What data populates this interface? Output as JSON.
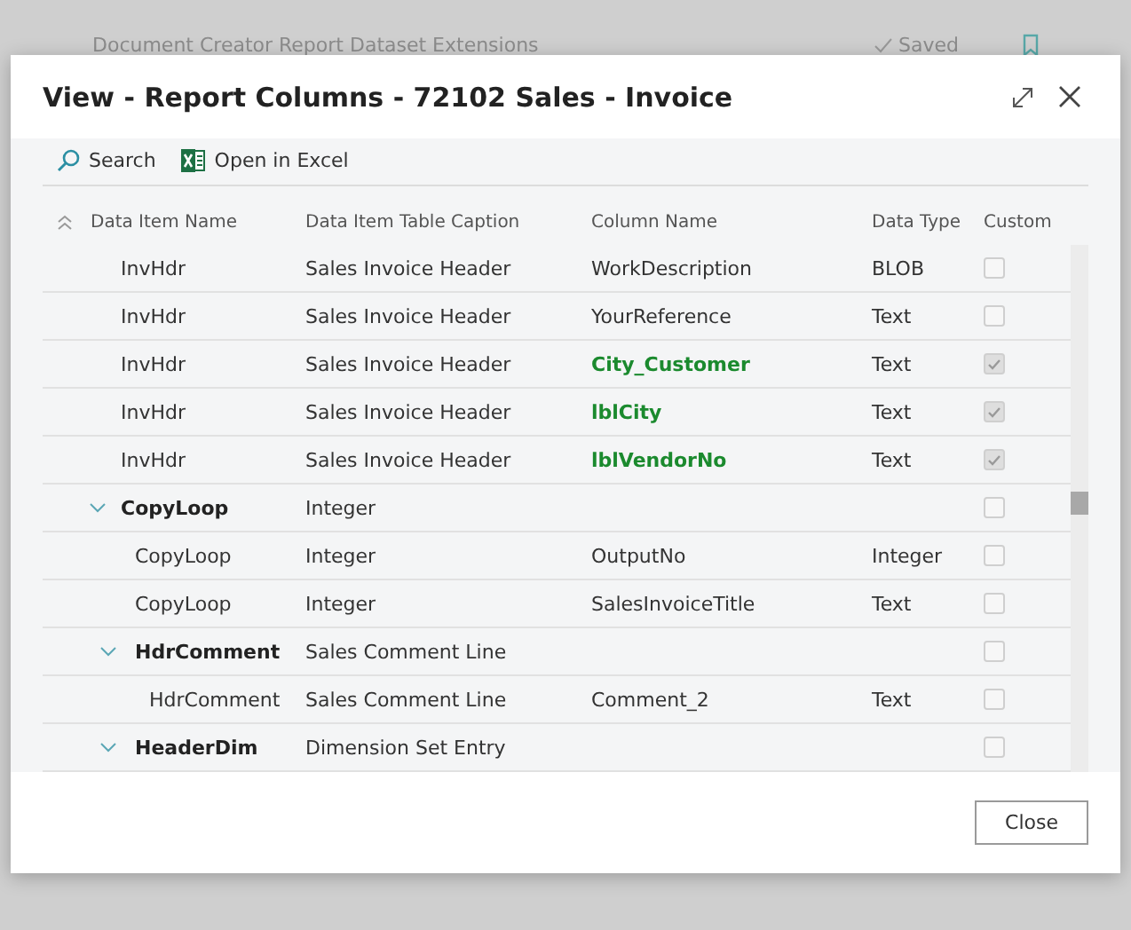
{
  "background": {
    "title": "Document Creator Report Dataset Extensions",
    "status": "Saved"
  },
  "dialog": {
    "title": "View - Report Columns - 72102 Sales - Invoice",
    "actions": [
      {
        "kind": "search",
        "label": "Search"
      },
      {
        "kind": "excel",
        "label": "Open in Excel"
      }
    ],
    "columns": [
      "Data Item Name",
      "Data Item Table Caption",
      "Column Name",
      "Data Type",
      "Custom"
    ],
    "rows": [
      {
        "name": "InvHdr",
        "caption": "Sales Invoice Header",
        "column": "WorkDescription",
        "type": "BLOB",
        "custom": false
      },
      {
        "name": "InvHdr",
        "caption": "Sales Invoice Header",
        "column": "YourReference",
        "type": "Text",
        "custom": false
      },
      {
        "name": "InvHdr",
        "caption": "Sales Invoice Header",
        "column": "City_Customer",
        "type": "Text",
        "custom": true
      },
      {
        "name": "InvHdr",
        "caption": "Sales Invoice Header",
        "column": "lblCity",
        "type": "Text",
        "custom": true
      },
      {
        "name": "InvHdr",
        "caption": "Sales Invoice Header",
        "column": "lblVendorNo",
        "type": "Text",
        "custom": true
      },
      {
        "name": "CopyLoop",
        "caption": "Integer",
        "custom": false,
        "expanded": true,
        "children": [
          {
            "name": "CopyLoop",
            "caption": "Integer",
            "column": "OutputNo",
            "type": "Integer",
            "custom": false
          },
          {
            "name": "CopyLoop",
            "caption": "Integer",
            "column": "SalesInvoiceTitle",
            "type": "Text",
            "custom": false
          },
          {
            "name": "HdrComment",
            "caption": "Sales Comment Line",
            "custom": false,
            "expanded": true,
            "children": [
              {
                "name": "HdrComment",
                "caption": "Sales Comment Line",
                "column": "Comment_2",
                "type": "Text",
                "custom": false
              }
            ]
          },
          {
            "name": "HeaderDim",
            "caption": "Dimension Set Entry",
            "custom": false,
            "expanded": true
          }
        ]
      }
    ],
    "close_button": "Close"
  }
}
